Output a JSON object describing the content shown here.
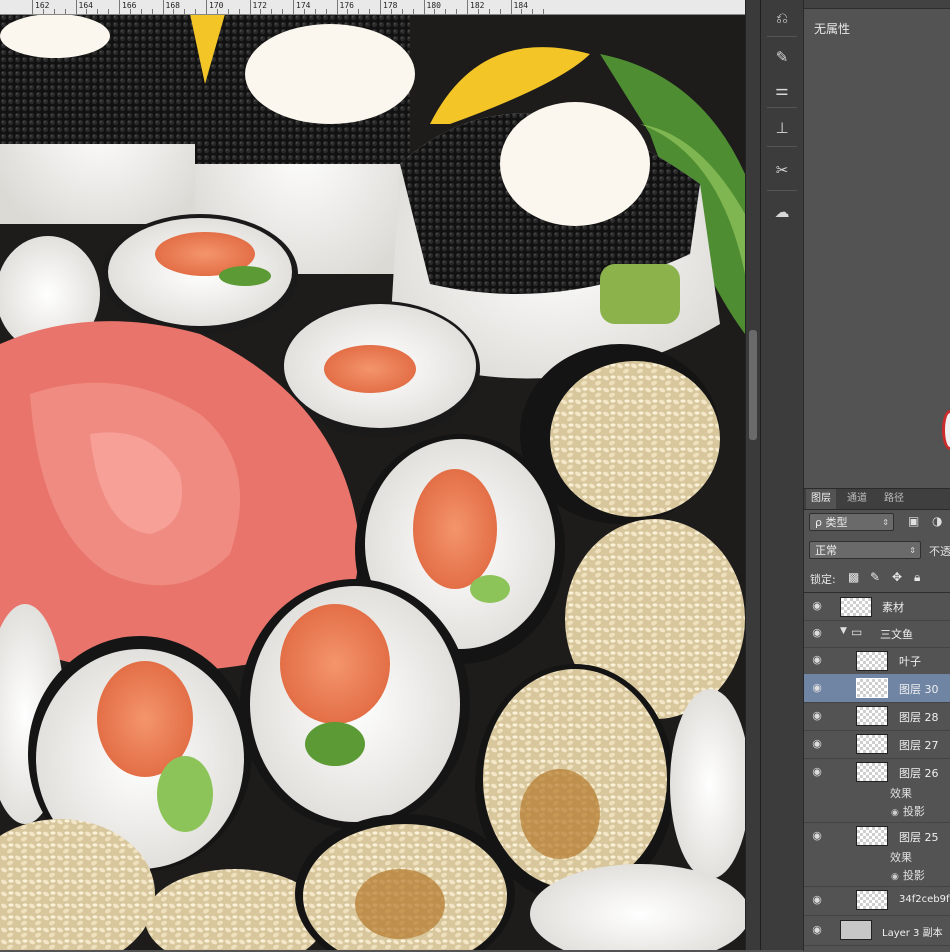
{
  "ruler": {
    "labels": [
      "162",
      "164",
      "166",
      "168",
      "170",
      "172",
      "174",
      "176",
      "178",
      "180",
      "182",
      "184"
    ]
  },
  "toolstrip": {
    "icons": [
      "history-icon",
      "brush-preset-icon",
      "adjust-icon",
      "clone-source-icon",
      "tool-preset-icon",
      "creative-cloud-icon"
    ]
  },
  "properties": {
    "empty_label": "无属性"
  },
  "layers_panel": {
    "tabs": [
      "图层",
      "通道",
      "路径"
    ],
    "filter_label": "ρ 类型",
    "blend_mode": "正常",
    "opacity_label": "不透",
    "lock_label": "锁定:",
    "layers": [
      {
        "name": "素材",
        "visible": true
      },
      {
        "name": "三文鱼",
        "visible": true,
        "is_group": true
      },
      {
        "name": "叶子",
        "visible": true
      },
      {
        "name": "图层 30",
        "visible": true,
        "selected": true
      },
      {
        "name": "图层 28",
        "visible": true
      },
      {
        "name": "图层 27",
        "visible": true
      },
      {
        "name": "图层 26",
        "visible": true,
        "effects_label": "效果",
        "effect": "投影"
      },
      {
        "name": "图层 25",
        "visible": true,
        "effects_label": "效果",
        "effect": "投影"
      },
      {
        "name": "34f2ceb9f",
        "visible": true
      },
      {
        "name": "Layer 3 副本",
        "visible": true
      }
    ]
  },
  "colors": {
    "panel_bg": "#535353",
    "selected_row": "#7085a4",
    "accent_red": "#cc2b2b"
  }
}
